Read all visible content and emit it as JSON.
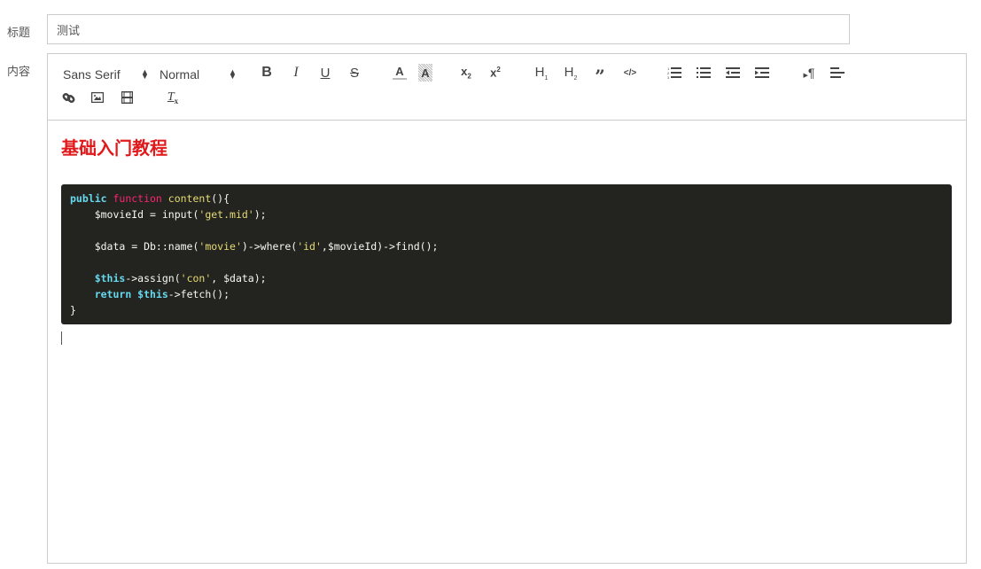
{
  "form": {
    "title_label": "标题",
    "title_value": "测试",
    "content_label": "内容"
  },
  "toolbar": {
    "font_picker": "Sans Serif",
    "size_picker": "Normal",
    "buttons": [
      {
        "name": "bold",
        "glyph": "B"
      },
      {
        "name": "italic",
        "glyph": "I"
      },
      {
        "name": "underline",
        "glyph": "U"
      },
      {
        "name": "strike",
        "glyph": "S"
      },
      {
        "name": "color",
        "glyph": "A"
      },
      {
        "name": "background",
        "glyph": "A"
      },
      {
        "name": "subscript",
        "glyph": "x₂"
      },
      {
        "name": "superscript",
        "glyph": "x²"
      },
      {
        "name": "header-1",
        "glyph": "H₁"
      },
      {
        "name": "header-2",
        "glyph": "H₂"
      },
      {
        "name": "blockquote",
        "glyph": "❞"
      },
      {
        "name": "code-block",
        "glyph": "</>"
      },
      {
        "name": "ordered-list",
        "glyph": "1≡"
      },
      {
        "name": "bullet-list",
        "glyph": "•≡"
      },
      {
        "name": "outdent",
        "glyph": "⇤"
      },
      {
        "name": "indent",
        "glyph": "⇥"
      },
      {
        "name": "direction",
        "glyph": "▸¶"
      },
      {
        "name": "align",
        "glyph": "≡"
      },
      {
        "name": "link",
        "glyph": "🔗"
      },
      {
        "name": "image",
        "glyph": "▣"
      },
      {
        "name": "video",
        "glyph": "▦"
      },
      {
        "name": "clean",
        "glyph": "Tx"
      }
    ]
  },
  "content": {
    "heading": "基础入门教程",
    "code_lines": [
      [
        {
          "t": "kw",
          "v": "public "
        },
        {
          "t": "fn",
          "v": "function "
        },
        {
          "t": "nm",
          "v": "content"
        },
        {
          "t": "",
          "v": "(){"
        }
      ],
      [
        {
          "t": "",
          "v": "    $movieId = input("
        },
        {
          "t": "st",
          "v": "'get.mid'"
        },
        {
          "t": "",
          "v": ");"
        }
      ],
      [
        {
          "t": "",
          "v": ""
        }
      ],
      [
        {
          "t": "",
          "v": "    $data = Db::name("
        },
        {
          "t": "st",
          "v": "'movie'"
        },
        {
          "t": "",
          "v": ")->where("
        },
        {
          "t": "st",
          "v": "'id'"
        },
        {
          "t": "",
          "v": ",$movieId)->find();"
        }
      ],
      [
        {
          "t": "",
          "v": ""
        }
      ],
      [
        {
          "t": "",
          "v": "    "
        },
        {
          "t": "kw",
          "v": "$this"
        },
        {
          "t": "",
          "v": "->assign("
        },
        {
          "t": "st",
          "v": "'con'"
        },
        {
          "t": "",
          "v": ", $data);"
        }
      ],
      [
        {
          "t": "",
          "v": "    "
        },
        {
          "t": "kw",
          "v": "return $this"
        },
        {
          "t": "",
          "v": "->fetch();"
        }
      ],
      [
        {
          "t": "",
          "v": "}"
        }
      ]
    ]
  }
}
